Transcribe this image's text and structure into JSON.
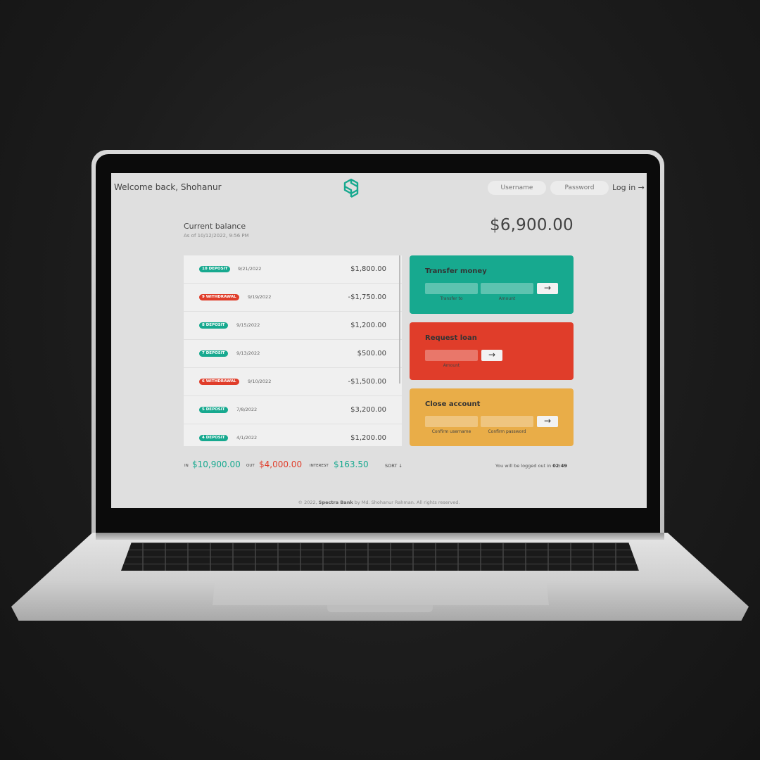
{
  "header": {
    "welcome": "Welcome back, Shohanur",
    "username_placeholder": "Username",
    "password_placeholder": "Password",
    "login_label": "Log in →"
  },
  "balance": {
    "label": "Current balance",
    "date": "As of 10/12/2022, 9:56 PM",
    "amount": "$6,900.00"
  },
  "movements": [
    {
      "type": "deposit",
      "badge": "10 DEPOSIT",
      "date": "9/21/2022",
      "value": "$1,800.00"
    },
    {
      "type": "withdrawal",
      "badge": "9 WITHDRAWAL",
      "date": "9/19/2022",
      "value": "-$1,750.00"
    },
    {
      "type": "deposit",
      "badge": "8 DEPOSIT",
      "date": "9/15/2022",
      "value": "$1,200.00"
    },
    {
      "type": "deposit",
      "badge": "7 DEPOSIT",
      "date": "9/13/2022",
      "value": "$500.00"
    },
    {
      "type": "withdrawal",
      "badge": "6 WITHDRAWAL",
      "date": "9/10/2022",
      "value": "-$1,500.00"
    },
    {
      "type": "deposit",
      "badge": "5 DEPOSIT",
      "date": "7/8/2022",
      "value": "$3,200.00"
    },
    {
      "type": "deposit",
      "badge": "4 DEPOSIT",
      "date": "4/1/2022",
      "value": "$1,200.00"
    }
  ],
  "operations": {
    "transfer": {
      "title": "Transfer money",
      "to_label": "Transfer to",
      "amount_label": "Amount",
      "button": "→"
    },
    "loan": {
      "title": "Request loan",
      "amount_label": "Amount",
      "button": "→"
    },
    "close": {
      "title": "Close account",
      "user_label": "Confirm username",
      "pin_label": "Confirm password",
      "button": "→"
    }
  },
  "summary": {
    "in_label": "In",
    "in_value": "$10,900.00",
    "out_label": "Out",
    "out_value": "$4,000.00",
    "interest_label": "Interest",
    "interest_value": "$163.50",
    "sort_label": "SORT ↓"
  },
  "timer": {
    "text": "You will be logged out in",
    "time": "02:49"
  },
  "footer": {
    "prefix": "© 2022,",
    "brand": "Spectra Bank",
    "suffix": "by Md. Shohanur Rahman. All rights reserved."
  },
  "colors": {
    "deposit": "#17a98f",
    "withdrawal": "#e03d2a",
    "close": "#e9ad48"
  }
}
